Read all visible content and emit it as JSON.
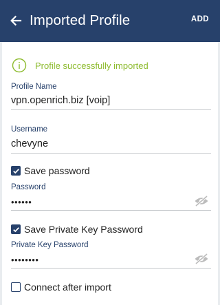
{
  "header": {
    "title": "Imported Profile",
    "action_label": "ADD"
  },
  "status": {
    "message": "Profile successfully imported"
  },
  "form": {
    "profile_name": {
      "label": "Profile Name",
      "value": "vpn.openrich.biz [voip]"
    },
    "username": {
      "label": "Username",
      "value": "chevyne"
    },
    "save_password": {
      "label": "Save password",
      "checked": true
    },
    "password": {
      "label": "Password",
      "value": "••••••"
    },
    "save_private_key_password": {
      "label": "Save Private Key Password",
      "checked": true
    },
    "private_key_password": {
      "label": "Private Key Password",
      "value": "••••••••"
    },
    "connect_after_import": {
      "label": "Connect after import",
      "checked": false
    }
  },
  "colors": {
    "appbar": "#27416b",
    "success": "#8dbb2e",
    "label": "#27416b"
  },
  "icons": {
    "back": "arrow-left-icon",
    "success": "info-circle-icon",
    "visibility": "eye-off-icon"
  }
}
